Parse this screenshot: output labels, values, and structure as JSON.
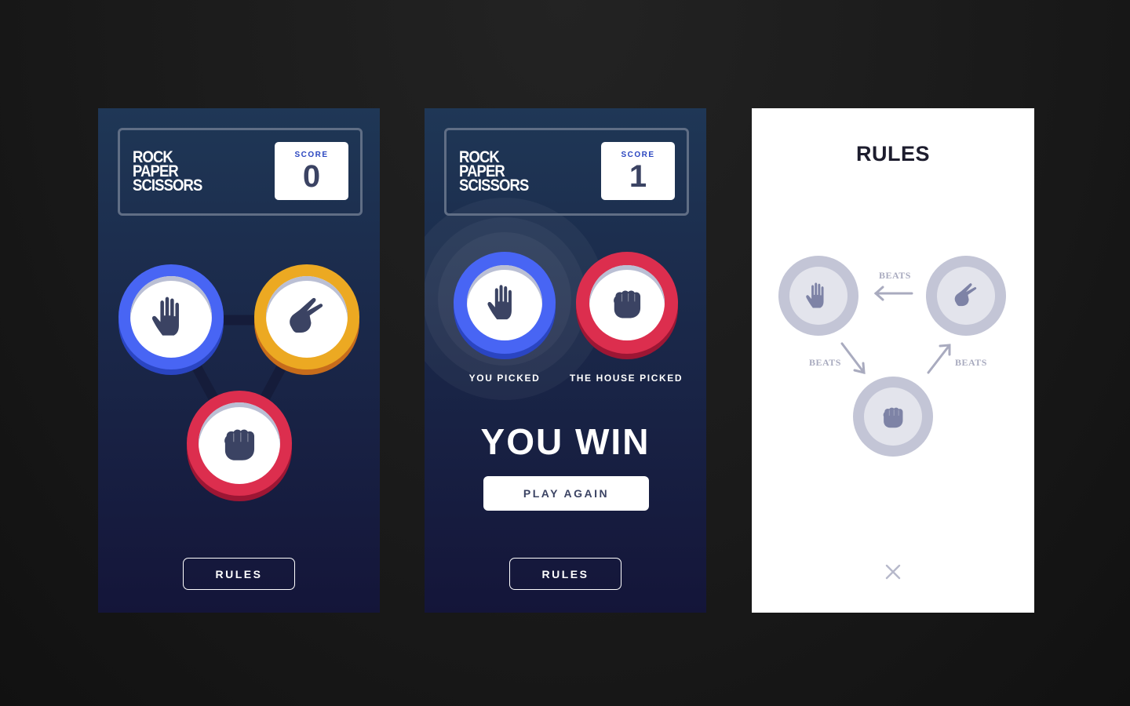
{
  "game": {
    "title_lines": [
      "ROCK",
      "PAPER",
      "SCISSORS"
    ],
    "score_label": "SCORE",
    "rules_button": "RULES"
  },
  "screen_select": {
    "score_value": "0",
    "choices": [
      "paper",
      "scissors",
      "rock"
    ]
  },
  "screen_result": {
    "score_value": "1",
    "you_picked_label": "YOU PICKED",
    "house_picked_label": "THE HOUSE PICKED",
    "you_picked": "paper",
    "house_picked": "rock",
    "result_text": "YOU WIN",
    "play_again": "PLAY AGAIN"
  },
  "screen_rules": {
    "title": "RULES",
    "beats_label": "BEATS",
    "close_icon": "close-icon"
  },
  "colors": {
    "paper": "#4865f4",
    "scissors": "#eca922",
    "rock": "#dc2e4e",
    "score_text": "#2a46c0",
    "dark_text": "#3b4363"
  }
}
